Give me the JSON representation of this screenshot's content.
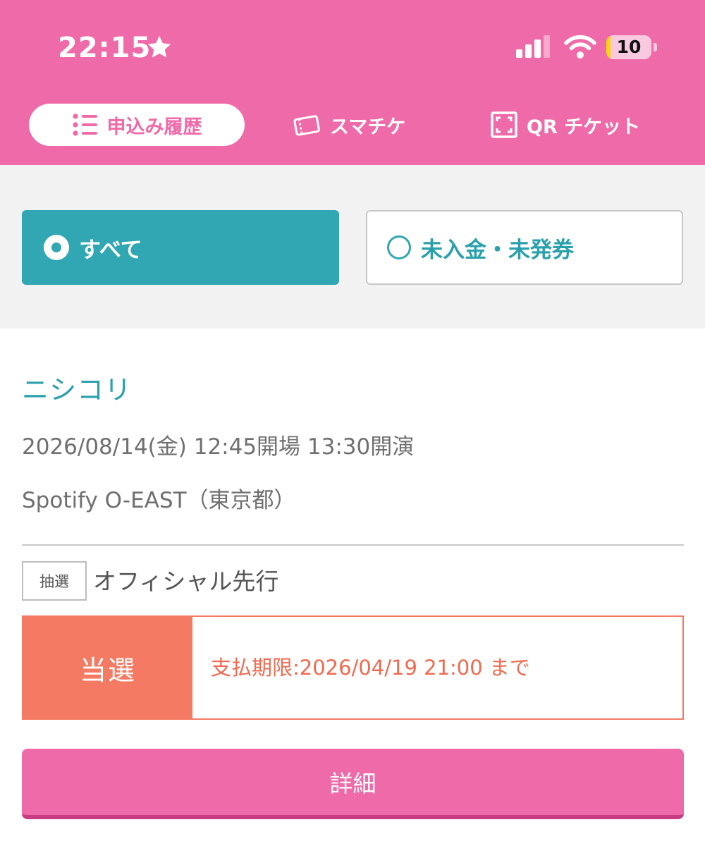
{
  "status_bar": {
    "time": "22:15",
    "battery_level": "10",
    "battery_fraction": 0.1,
    "icons": [
      "star-icon",
      "signal-icon",
      "wifi-icon",
      "battery-icon"
    ]
  },
  "tabs": [
    {
      "label": "申込み履歴",
      "icon": "list-icon",
      "active": true
    },
    {
      "label": "スマチケ",
      "icon": "ticket-icon",
      "active": false
    },
    {
      "label": "QR チケット",
      "icon": "qr-scan-icon",
      "active": false
    }
  ],
  "filters": {
    "all_label": "すべて",
    "unpaid_label": "未入金・未発券",
    "selected": "all"
  },
  "event": {
    "title": "ニシコリ",
    "datetime": "2026/08/14(金) 12:45開場 13:30開演",
    "venue": "Spotify O-EAST（東京都）",
    "lottery_badge": "抽選",
    "sale_type": "オフィシャル先行",
    "result": "当選",
    "deadline": "支払期限:2026/04/19 21:00 まで"
  },
  "detail_button": "詳細",
  "colors": {
    "brand_pink": "#ef6aa8",
    "teal": "#31a7b3",
    "result_orange": "#f47a63",
    "text_gray": "#6f6f6f"
  }
}
